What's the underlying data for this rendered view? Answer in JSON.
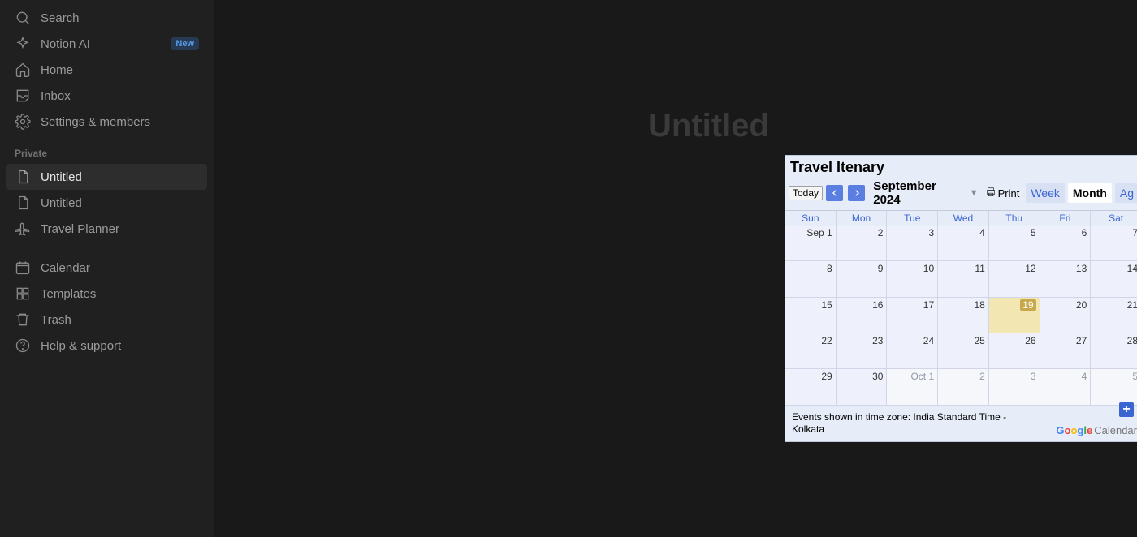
{
  "sidebar": {
    "search": "Search",
    "notion_ai": "Notion AI",
    "notion_ai_badge": "New",
    "home": "Home",
    "inbox": "Inbox",
    "settings": "Settings & members",
    "section_private": "Private",
    "pages": [
      {
        "label": "Untitled",
        "icon": "page",
        "active": true
      },
      {
        "label": "Untitled",
        "icon": "page",
        "active": false
      },
      {
        "label": "Travel Planner",
        "icon": "plane",
        "active": false
      }
    ],
    "calendar": "Calendar",
    "templates": "Templates",
    "trash": "Trash",
    "help": "Help & support"
  },
  "page": {
    "title": "Untitled"
  },
  "calendar_embed": {
    "title": "Travel Itenary",
    "today_btn": "Today",
    "month_label": "September 2024",
    "print": "Print",
    "views": {
      "week": "Week",
      "month": "Month",
      "agenda": "Ag"
    },
    "dow": [
      "Sun",
      "Mon",
      "Tue",
      "Wed",
      "Thu",
      "Fri",
      "Sat"
    ],
    "weeks": [
      [
        "Sep 1",
        "2",
        "3",
        "4",
        "5",
        "6",
        "7"
      ],
      [
        "8",
        "9",
        "10",
        "11",
        "12",
        "13",
        "14"
      ],
      [
        "15",
        "16",
        "17",
        "18",
        "19",
        "20",
        "21"
      ],
      [
        "22",
        "23",
        "24",
        "25",
        "26",
        "27",
        "28"
      ],
      [
        "29",
        "30",
        "Oct 1",
        "2",
        "3",
        "4",
        "5"
      ]
    ],
    "today_cell": {
      "week": 2,
      "day": 4
    },
    "other_month_start": {
      "week": 4,
      "day": 2
    },
    "timezone_text": "Events shown in time zone: India Standard Time - Kolkata",
    "brand_cal": "Calendar"
  }
}
